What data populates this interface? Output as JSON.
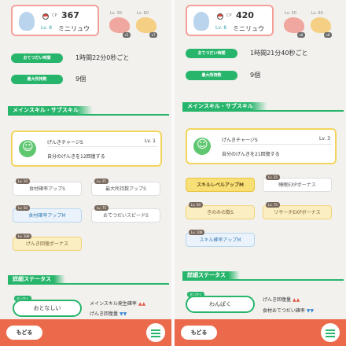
{
  "colors": {
    "accent_green": "#27b56b",
    "bottom_bar": "#ec6a4c",
    "card_gold": "#f3d45e"
  },
  "left": {
    "pokemon": {
      "cp_label": "CP",
      "cp_value": "367",
      "level": "Lv. 8",
      "name": "ミニリュウ"
    },
    "evolutions": [
      {
        "level": "Lv. 30",
        "badge": "x5"
      },
      {
        "level": "Lv. 60",
        "badge": "x7"
      }
    ],
    "info": [
      {
        "label": "おてつだい時間",
        "value": "1時間22分0秒ごと"
      },
      {
        "label": "最大所持数",
        "value": "9個"
      }
    ],
    "section_skills": "メインスキル・サブスキル",
    "main_skill": {
      "name": "げんきチャージS",
      "level": "Lv. 1",
      "description": "自分のげんきを12回復する"
    },
    "subskills": [
      {
        "lv": "Lv. 10",
        "label": "食材確率アップS",
        "style": "white"
      },
      {
        "lv": "Lv. 25",
        "label": "最大所持数アップS",
        "style": "white"
      },
      {
        "lv": "Lv. 50",
        "label": "食材確率アップM",
        "style": "blue"
      },
      {
        "lv": "Lv. 75",
        "label": "おてつだいスピードS",
        "style": "white"
      },
      {
        "lv": "Lv. 100",
        "label": "げんき回復ボーナス",
        "style": "gold"
      }
    ],
    "section_status": "詳細ステータス",
    "nature_tag": "せいかく",
    "nature": "おとなしい",
    "stats": [
      {
        "label": "メインスキル発生確率",
        "dir": "▲▲"
      },
      {
        "label": "げんき回復量",
        "dir": "▼▼"
      }
    ],
    "back": "もどる"
  },
  "right": {
    "pokemon": {
      "cp_label": "CP",
      "cp_value": "420",
      "level": "Lv. 8",
      "name": "ミニリュウ"
    },
    "evolutions": [
      {
        "level": "Lv. 30",
        "badge": "x6"
      },
      {
        "level": "Lv. 60",
        "badge": "x8"
      }
    ],
    "info": [
      {
        "label": "おてつだい時間",
        "value": "1時間21分40秒ごと"
      },
      {
        "label": "最大所持数",
        "value": "9個"
      }
    ],
    "section_skills": "メインスキル・サブスキル",
    "main_skill": {
      "name": "げんきチャージS",
      "level": "Lv. 3",
      "description": "自分のげんきを21回復する"
    },
    "subskills": [
      {
        "lv": "",
        "label": "スキルレベルアップM",
        "style": "gold-strong"
      },
      {
        "lv": "Lv. 25",
        "label": "睡眠EXPボーナス",
        "style": "white"
      },
      {
        "lv": "Lv. 50",
        "label": "きのみの数S",
        "style": "gold"
      },
      {
        "lv": "Lv. 75",
        "label": "リサーチEXPボーナス",
        "style": "gold"
      },
      {
        "lv": "Lv. 100",
        "label": "スキル確率アップM",
        "style": "blue"
      }
    ],
    "section_status": "詳細ステータス",
    "nature_tag": "せいかく",
    "nature": "わんぱく",
    "stats": [
      {
        "label": "げんき回復量",
        "dir": "▲▲"
      },
      {
        "label": "食材おてつだい確率",
        "dir": "▼▼"
      }
    ],
    "back": "もどる"
  }
}
